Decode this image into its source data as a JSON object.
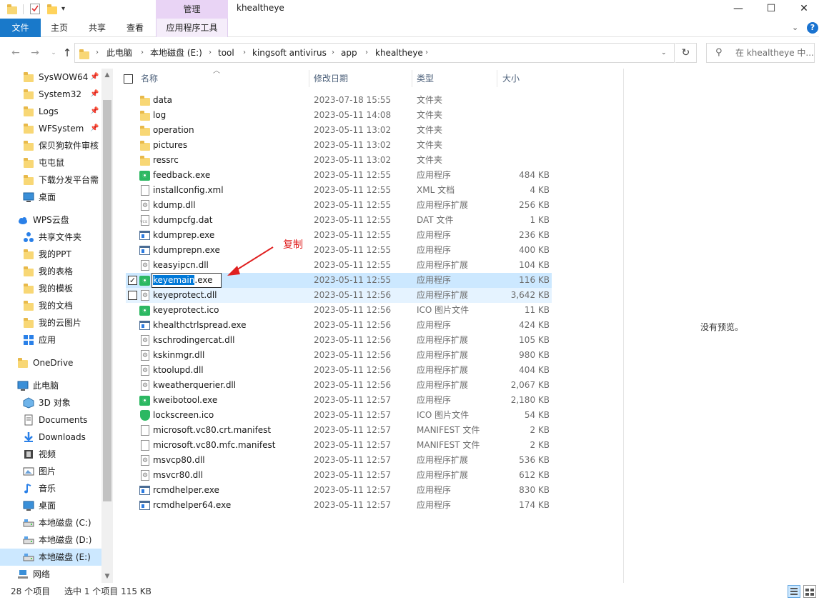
{
  "window": {
    "title": "khealtheye",
    "context_tab_header": "管理",
    "minimize": "—",
    "maximize": "☐",
    "close": "✕"
  },
  "ribbon": {
    "tabs": [
      "文件",
      "主页",
      "共享",
      "查看",
      "应用程序工具"
    ],
    "expand": "⌄",
    "help": "?"
  },
  "address": {
    "crumbs": [
      "此电脑",
      "本地磁盘 (E:)",
      "tool",
      "kingsoft antivirus",
      "app",
      "khealtheye"
    ],
    "search_placeholder": "在 khealtheye 中..."
  },
  "nav_pane": {
    "items": [
      {
        "label": "SysWOW64",
        "icon": "folder-icon",
        "pinned": true
      },
      {
        "label": "System32",
        "icon": "folder-icon",
        "pinned": true
      },
      {
        "label": "Logs",
        "icon": "folder-icon",
        "pinned": true
      },
      {
        "label": "WFSystem",
        "icon": "folder-icon",
        "pinned": true
      },
      {
        "label": "保贝狗软件审核",
        "icon": "folder-icon",
        "pinned": false
      },
      {
        "label": "屯屯鼠",
        "icon": "folder-icon",
        "pinned": false
      },
      {
        "label": "下载分发平台需",
        "icon": "folder-icon",
        "pinned": false
      },
      {
        "label": "桌面",
        "icon": "desktop-icon",
        "pinned": false
      },
      {
        "label": "WPS云盘",
        "icon": "cloud-icon",
        "pinned": false
      },
      {
        "label": "共享文件夹",
        "icon": "share-icon",
        "pinned": false
      },
      {
        "label": "我的PPT",
        "icon": "folder-icon",
        "pinned": false
      },
      {
        "label": "我的表格",
        "icon": "folder-icon",
        "pinned": false
      },
      {
        "label": "我的模板",
        "icon": "folder-icon",
        "pinned": false
      },
      {
        "label": "我的文档",
        "icon": "folder-icon",
        "pinned": false
      },
      {
        "label": "我的云图片",
        "icon": "folder-icon",
        "pinned": false
      },
      {
        "label": "应用",
        "icon": "apps-icon",
        "pinned": false
      },
      {
        "label": "OneDrive",
        "icon": "folder-icon",
        "pinned": false
      },
      {
        "label": "此电脑",
        "icon": "computer-icon",
        "pinned": false
      },
      {
        "label": "3D 对象",
        "icon": "cube-icon",
        "pinned": false
      },
      {
        "label": "Documents",
        "icon": "documents-icon",
        "pinned": false
      },
      {
        "label": "Downloads",
        "icon": "download-icon",
        "pinned": false
      },
      {
        "label": "视频",
        "icon": "video-icon",
        "pinned": false
      },
      {
        "label": "图片",
        "icon": "pictures-icon",
        "pinned": false
      },
      {
        "label": "音乐",
        "icon": "music-icon",
        "pinned": false
      },
      {
        "label": "桌面",
        "icon": "desktop-icon",
        "pinned": false
      },
      {
        "label": "本地磁盘 (C:)",
        "icon": "drive-icon",
        "pinned": false
      },
      {
        "label": "本地磁盘 (D:)",
        "icon": "drive-icon",
        "pinned": false
      },
      {
        "label": "本地磁盘 (E:)",
        "icon": "drive-icon",
        "pinned": false,
        "selected": true
      },
      {
        "label": "网络",
        "icon": "network-icon",
        "pinned": false
      }
    ]
  },
  "columns": {
    "name": "名称",
    "date": "修改日期",
    "type": "类型",
    "size": "大小"
  },
  "files": [
    {
      "name": "data",
      "date": "2023-07-18 15:55",
      "type": "文件夹",
      "size": "",
      "icon": "folder-icon"
    },
    {
      "name": "log",
      "date": "2023-05-11 14:08",
      "type": "文件夹",
      "size": "",
      "icon": "folder-icon"
    },
    {
      "name": "operation",
      "date": "2023-05-11 13:02",
      "type": "文件夹",
      "size": "",
      "icon": "folder-icon"
    },
    {
      "name": "pictures",
      "date": "2023-05-11 13:02",
      "type": "文件夹",
      "size": "",
      "icon": "folder-icon"
    },
    {
      "name": "ressrc",
      "date": "2023-05-11 13:02",
      "type": "文件夹",
      "size": "",
      "icon": "folder-icon"
    },
    {
      "name": "feedback.exe",
      "date": "2023-05-11 12:55",
      "type": "应用程序",
      "size": "484 KB",
      "icon": "eye-exe-icon"
    },
    {
      "name": "installconfig.xml",
      "date": "2023-05-11 12:55",
      "type": "XML 文档",
      "size": "4 KB",
      "icon": "document-icon"
    },
    {
      "name": "kdump.dll",
      "date": "2023-05-11 12:55",
      "type": "应用程序扩展",
      "size": "256 KB",
      "icon": "dll-icon"
    },
    {
      "name": "kdumpcfg.dat",
      "date": "2023-05-11 12:55",
      "type": "DAT 文件",
      "size": "1 KB",
      "icon": "dat-icon"
    },
    {
      "name": "kdumprep.exe",
      "date": "2023-05-11 12:55",
      "type": "应用程序",
      "size": "236 KB",
      "icon": "app-window-icon"
    },
    {
      "name": "kdumprepn.exe",
      "date": "2023-05-11 12:55",
      "type": "应用程序",
      "size": "400 KB",
      "icon": "app-window-icon"
    },
    {
      "name": "keasyipcn.dll",
      "date": "2023-05-11 12:55",
      "type": "应用程序扩展",
      "size": "104 KB",
      "icon": "dll-icon"
    },
    {
      "name": "keyemain.exe",
      "date": "2023-05-11 12:55",
      "type": "应用程序",
      "size": "116 KB",
      "icon": "eye-exe-icon",
      "selected": true,
      "renaming": true,
      "rename_selected": "keyemain",
      "rename_rest": ".exe"
    },
    {
      "name": "keyeprotect.dll",
      "date": "2023-05-11 12:56",
      "type": "应用程序扩展",
      "size": "3,642 KB",
      "icon": "dll-icon",
      "hover": true
    },
    {
      "name": "keyeprotect.ico",
      "date": "2023-05-11 12:56",
      "type": "ICO 图片文件",
      "size": "11 KB",
      "icon": "eye-exe-icon"
    },
    {
      "name": "khealthctrlspread.exe",
      "date": "2023-05-11 12:56",
      "type": "应用程序",
      "size": "424 KB",
      "icon": "app-window-icon"
    },
    {
      "name": "kschrodingercat.dll",
      "date": "2023-05-11 12:56",
      "type": "应用程序扩展",
      "size": "105 KB",
      "icon": "dll-icon"
    },
    {
      "name": "kskinmgr.dll",
      "date": "2023-05-11 12:56",
      "type": "应用程序扩展",
      "size": "980 KB",
      "icon": "dll-icon"
    },
    {
      "name": "ktoolupd.dll",
      "date": "2023-05-11 12:56",
      "type": "应用程序扩展",
      "size": "404 KB",
      "icon": "dll-icon"
    },
    {
      "name": "kweatherquerier.dll",
      "date": "2023-05-11 12:56",
      "type": "应用程序扩展",
      "size": "2,067 KB",
      "icon": "dll-icon"
    },
    {
      "name": "kweibotool.exe",
      "date": "2023-05-11 12:57",
      "type": "应用程序",
      "size": "2,180 KB",
      "icon": "eye-exe-icon"
    },
    {
      "name": "lockscreen.ico",
      "date": "2023-05-11 12:57",
      "type": "ICO 图片文件",
      "size": "54 KB",
      "icon": "shield-icon"
    },
    {
      "name": "microsoft.vc80.crt.manifest",
      "date": "2023-05-11 12:57",
      "type": "MANIFEST 文件",
      "size": "2 KB",
      "icon": "document-icon"
    },
    {
      "name": "microsoft.vc80.mfc.manifest",
      "date": "2023-05-11 12:57",
      "type": "MANIFEST 文件",
      "size": "2 KB",
      "icon": "document-icon"
    },
    {
      "name": "msvcp80.dll",
      "date": "2023-05-11 12:57",
      "type": "应用程序扩展",
      "size": "536 KB",
      "icon": "dll-icon"
    },
    {
      "name": "msvcr80.dll",
      "date": "2023-05-11 12:57",
      "type": "应用程序扩展",
      "size": "612 KB",
      "icon": "dll-icon"
    },
    {
      "name": "rcmdhelper.exe",
      "date": "2023-05-11 12:57",
      "type": "应用程序",
      "size": "830 KB",
      "icon": "app-window-icon"
    },
    {
      "name": "rcmdhelper64.exe",
      "date": "2023-05-11 12:57",
      "type": "应用程序",
      "size": "174 KB",
      "icon": "app-window-icon"
    }
  ],
  "annotation": {
    "label": "复制",
    "color": "#e02020"
  },
  "preview": {
    "empty_text": "没有预览。"
  },
  "status": {
    "item_count": "28 个项目",
    "selection": "选中 1 个项目  115 KB"
  },
  "colors": {
    "accent": "#1979ca",
    "selection": "#cce8ff",
    "context_tab": "#e9d4f5"
  }
}
